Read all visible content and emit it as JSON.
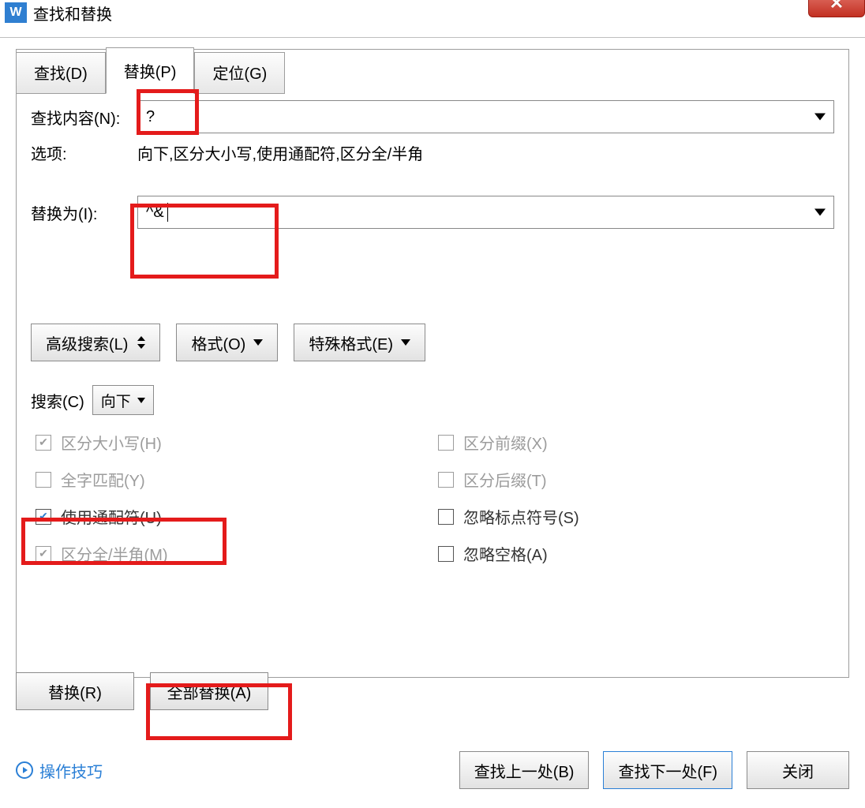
{
  "titlebar": {
    "app_icon_letter": "W",
    "title": "查找和替换"
  },
  "tabs": {
    "find": "查找(D)",
    "replace": "替换(P)",
    "goto": "定位(G)"
  },
  "find": {
    "label": "查找内容(N):",
    "value": "?",
    "options_label": "选项:",
    "options_text": "向下,区分大小写,使用通配符,区分全/半角"
  },
  "replace": {
    "label": "替换为(I):",
    "value": "^& "
  },
  "adv_buttons": {
    "adv_search": "高级搜索(L)",
    "format": "格式(O)",
    "special": "特殊格式(E)"
  },
  "search_dir": {
    "label": "搜索(C)",
    "value": "向下"
  },
  "checks": {
    "left": [
      {
        "label": "区分大小写(H)",
        "checked": true,
        "enabled": false
      },
      {
        "label": "全字匹配(Y)",
        "checked": false,
        "enabled": false
      },
      {
        "label": "使用通配符(U)",
        "checked": true,
        "enabled": true
      },
      {
        "label": "区分全/半角(M)",
        "checked": true,
        "enabled": false
      }
    ],
    "right": [
      {
        "label": "区分前缀(X)",
        "checked": false,
        "enabled": false
      },
      {
        "label": "区分后缀(T)",
        "checked": false,
        "enabled": false
      },
      {
        "label": "忽略标点符号(S)",
        "checked": false,
        "enabled": true
      },
      {
        "label": "忽略空格(A)",
        "checked": false,
        "enabled": true
      }
    ]
  },
  "bottom": {
    "replace": "替换(R)",
    "replace_all": "全部替换(A)"
  },
  "footer": {
    "tips": "操作技巧",
    "find_prev": "查找上一处(B)",
    "find_next": "查找下一处(F)",
    "close": "关闭"
  }
}
